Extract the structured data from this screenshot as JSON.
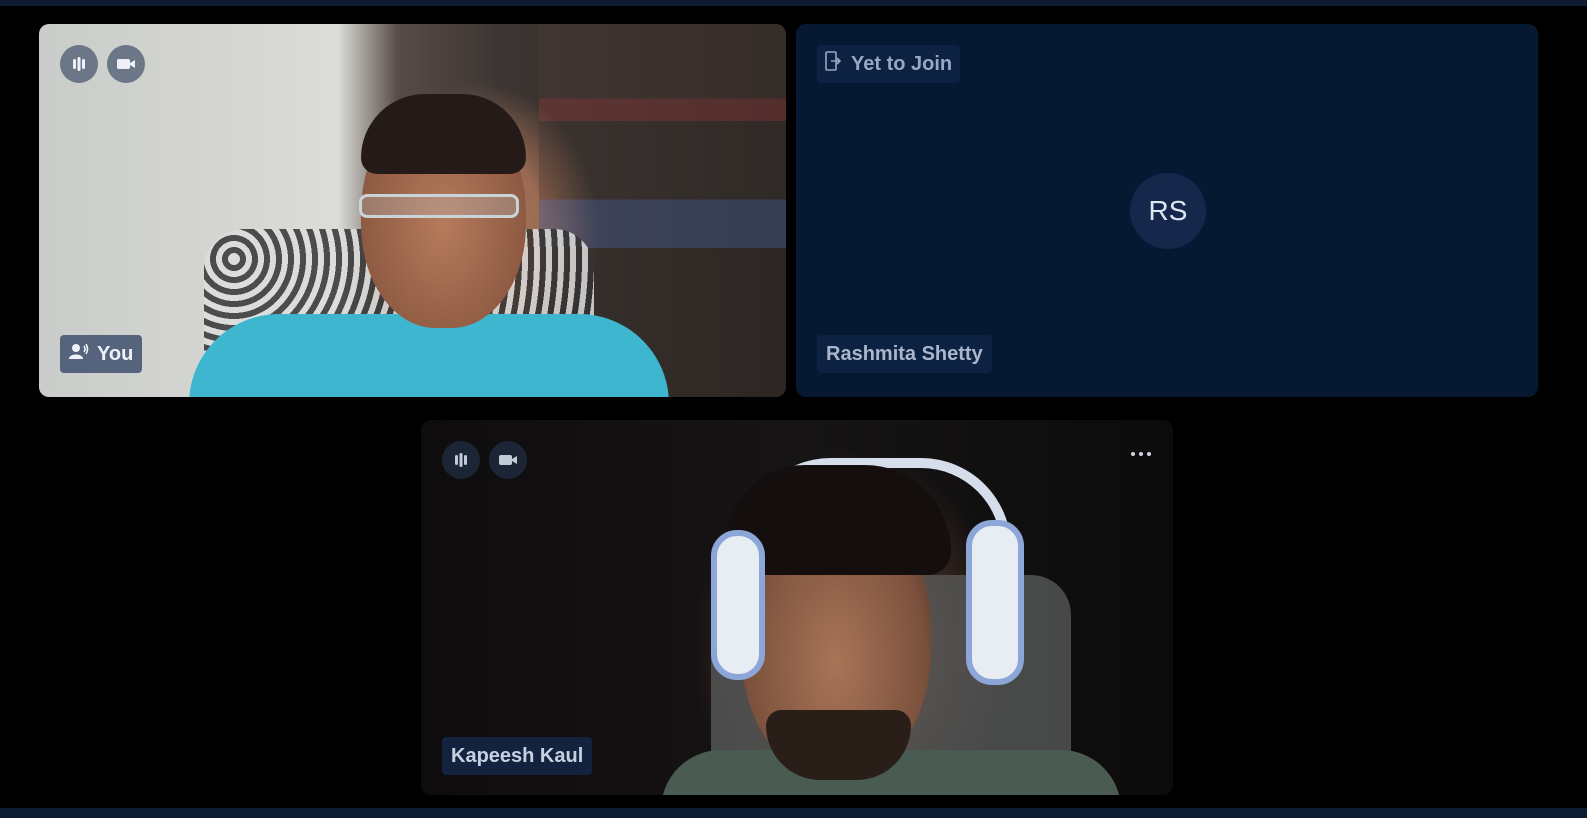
{
  "tiles": {
    "self": {
      "name": "You",
      "controls": {
        "mic_icon": "audio-level-icon",
        "camera_icon": "video-camera-icon"
      },
      "speaker_icon": "speaking-user-icon"
    },
    "waiting": {
      "status": "Yet to Join",
      "status_icon": "enter-door-icon",
      "initials": "RS",
      "name": "Rashmita Shetty"
    },
    "remote": {
      "name": "Kapeesh Kaul",
      "controls": {
        "mic_icon": "audio-level-icon",
        "camera_icon": "video-camera-icon"
      },
      "menu_icon": "more-horizontal-icon"
    }
  },
  "colors": {
    "background": "#000000",
    "waiting_tile": "#071833",
    "avatar": "#15284c",
    "accent_bar": "#0d1b33"
  }
}
